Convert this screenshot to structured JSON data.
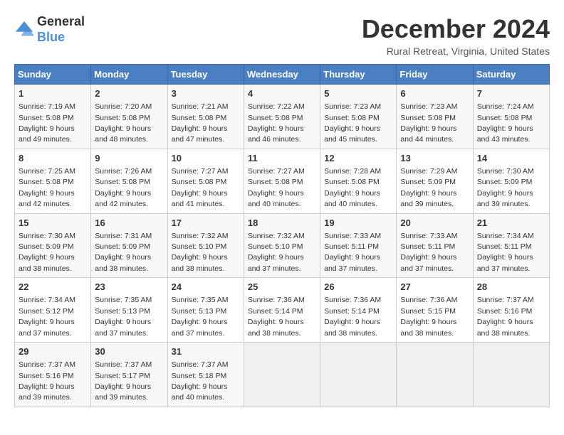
{
  "logo": {
    "line1": "General",
    "line2": "Blue"
  },
  "title": "December 2024",
  "subtitle": "Rural Retreat, Virginia, United States",
  "days_of_week": [
    "Sunday",
    "Monday",
    "Tuesday",
    "Wednesday",
    "Thursday",
    "Friday",
    "Saturday"
  ],
  "weeks": [
    [
      {
        "day": "1",
        "info": "Sunrise: 7:19 AM\nSunset: 5:08 PM\nDaylight: 9 hours\nand 49 minutes."
      },
      {
        "day": "2",
        "info": "Sunrise: 7:20 AM\nSunset: 5:08 PM\nDaylight: 9 hours\nand 48 minutes."
      },
      {
        "day": "3",
        "info": "Sunrise: 7:21 AM\nSunset: 5:08 PM\nDaylight: 9 hours\nand 47 minutes."
      },
      {
        "day": "4",
        "info": "Sunrise: 7:22 AM\nSunset: 5:08 PM\nDaylight: 9 hours\nand 46 minutes."
      },
      {
        "day": "5",
        "info": "Sunrise: 7:23 AM\nSunset: 5:08 PM\nDaylight: 9 hours\nand 45 minutes."
      },
      {
        "day": "6",
        "info": "Sunrise: 7:23 AM\nSunset: 5:08 PM\nDaylight: 9 hours\nand 44 minutes."
      },
      {
        "day": "7",
        "info": "Sunrise: 7:24 AM\nSunset: 5:08 PM\nDaylight: 9 hours\nand 43 minutes."
      }
    ],
    [
      {
        "day": "8",
        "info": "Sunrise: 7:25 AM\nSunset: 5:08 PM\nDaylight: 9 hours\nand 42 minutes."
      },
      {
        "day": "9",
        "info": "Sunrise: 7:26 AM\nSunset: 5:08 PM\nDaylight: 9 hours\nand 42 minutes."
      },
      {
        "day": "10",
        "info": "Sunrise: 7:27 AM\nSunset: 5:08 PM\nDaylight: 9 hours\nand 41 minutes."
      },
      {
        "day": "11",
        "info": "Sunrise: 7:27 AM\nSunset: 5:08 PM\nDaylight: 9 hours\nand 40 minutes."
      },
      {
        "day": "12",
        "info": "Sunrise: 7:28 AM\nSunset: 5:08 PM\nDaylight: 9 hours\nand 40 minutes."
      },
      {
        "day": "13",
        "info": "Sunrise: 7:29 AM\nSunset: 5:09 PM\nDaylight: 9 hours\nand 39 minutes."
      },
      {
        "day": "14",
        "info": "Sunrise: 7:30 AM\nSunset: 5:09 PM\nDaylight: 9 hours\nand 39 minutes."
      }
    ],
    [
      {
        "day": "15",
        "info": "Sunrise: 7:30 AM\nSunset: 5:09 PM\nDaylight: 9 hours\nand 38 minutes."
      },
      {
        "day": "16",
        "info": "Sunrise: 7:31 AM\nSunset: 5:09 PM\nDaylight: 9 hours\nand 38 minutes."
      },
      {
        "day": "17",
        "info": "Sunrise: 7:32 AM\nSunset: 5:10 PM\nDaylight: 9 hours\nand 38 minutes."
      },
      {
        "day": "18",
        "info": "Sunrise: 7:32 AM\nSunset: 5:10 PM\nDaylight: 9 hours\nand 37 minutes."
      },
      {
        "day": "19",
        "info": "Sunrise: 7:33 AM\nSunset: 5:11 PM\nDaylight: 9 hours\nand 37 minutes."
      },
      {
        "day": "20",
        "info": "Sunrise: 7:33 AM\nSunset: 5:11 PM\nDaylight: 9 hours\nand 37 minutes."
      },
      {
        "day": "21",
        "info": "Sunrise: 7:34 AM\nSunset: 5:11 PM\nDaylight: 9 hours\nand 37 minutes."
      }
    ],
    [
      {
        "day": "22",
        "info": "Sunrise: 7:34 AM\nSunset: 5:12 PM\nDaylight: 9 hours\nand 37 minutes."
      },
      {
        "day": "23",
        "info": "Sunrise: 7:35 AM\nSunset: 5:13 PM\nDaylight: 9 hours\nand 37 minutes."
      },
      {
        "day": "24",
        "info": "Sunrise: 7:35 AM\nSunset: 5:13 PM\nDaylight: 9 hours\nand 37 minutes."
      },
      {
        "day": "25",
        "info": "Sunrise: 7:36 AM\nSunset: 5:14 PM\nDaylight: 9 hours\nand 38 minutes."
      },
      {
        "day": "26",
        "info": "Sunrise: 7:36 AM\nSunset: 5:14 PM\nDaylight: 9 hours\nand 38 minutes."
      },
      {
        "day": "27",
        "info": "Sunrise: 7:36 AM\nSunset: 5:15 PM\nDaylight: 9 hours\nand 38 minutes."
      },
      {
        "day": "28",
        "info": "Sunrise: 7:37 AM\nSunset: 5:16 PM\nDaylight: 9 hours\nand 38 minutes."
      }
    ],
    [
      {
        "day": "29",
        "info": "Sunrise: 7:37 AM\nSunset: 5:16 PM\nDaylight: 9 hours\nand 39 minutes."
      },
      {
        "day": "30",
        "info": "Sunrise: 7:37 AM\nSunset: 5:17 PM\nDaylight: 9 hours\nand 39 minutes."
      },
      {
        "day": "31",
        "info": "Sunrise: 7:37 AM\nSunset: 5:18 PM\nDaylight: 9 hours\nand 40 minutes."
      },
      {
        "day": "",
        "info": ""
      },
      {
        "day": "",
        "info": ""
      },
      {
        "day": "",
        "info": ""
      },
      {
        "day": "",
        "info": ""
      }
    ]
  ],
  "colors": {
    "header_bg": "#4a7fc1",
    "header_text": "#ffffff",
    "odd_row": "#f8f8f8",
    "even_row": "#ffffff",
    "empty_cell": "#f0f0f0"
  }
}
